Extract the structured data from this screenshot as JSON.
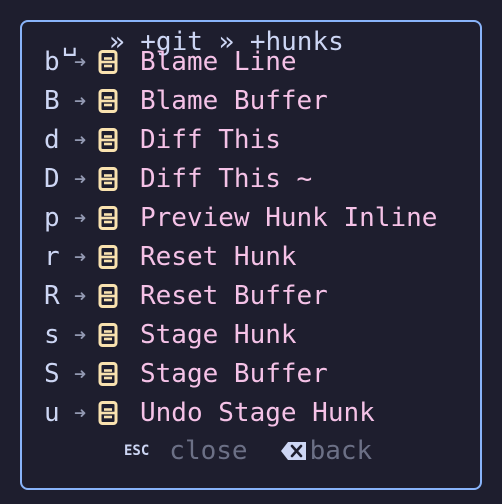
{
  "popup": {
    "title": "␣  » +git » +hunks",
    "border_color": "#89b4fa",
    "background": "#1e1e2e"
  },
  "mappings": [
    {
      "key": "b",
      "arrow": "➜",
      "icon": "git-icon",
      "desc": "Blame Line"
    },
    {
      "key": "B",
      "arrow": "➜",
      "icon": "git-icon",
      "desc": "Blame Buffer"
    },
    {
      "key": "d",
      "arrow": "➜",
      "icon": "git-icon",
      "desc": "Diff This"
    },
    {
      "key": "D",
      "arrow": "➜",
      "icon": "git-icon",
      "desc": "Diff This ~"
    },
    {
      "key": "p",
      "arrow": "➜",
      "icon": "git-icon",
      "desc": "Preview Hunk Inline"
    },
    {
      "key": "r",
      "arrow": "➜",
      "icon": "git-icon",
      "desc": "Reset Hunk"
    },
    {
      "key": "R",
      "arrow": "➜",
      "icon": "git-icon",
      "desc": "Reset Buffer"
    },
    {
      "key": "s",
      "arrow": "➜",
      "icon": "git-icon",
      "desc": "Stage Hunk"
    },
    {
      "key": "S",
      "arrow": "➜",
      "icon": "git-icon",
      "desc": "Stage Buffer"
    },
    {
      "key": "u",
      "arrow": "➜",
      "icon": "git-icon",
      "desc": "Undo Stage Hunk"
    }
  ],
  "footer": {
    "esc_key": "ESC",
    "close_label": "close",
    "back_label": "back"
  },
  "colors": {
    "key": "#cdd6f4",
    "desc": "#f5c2e7",
    "icon": "#f9e2af",
    "muted": "#6c7086"
  }
}
